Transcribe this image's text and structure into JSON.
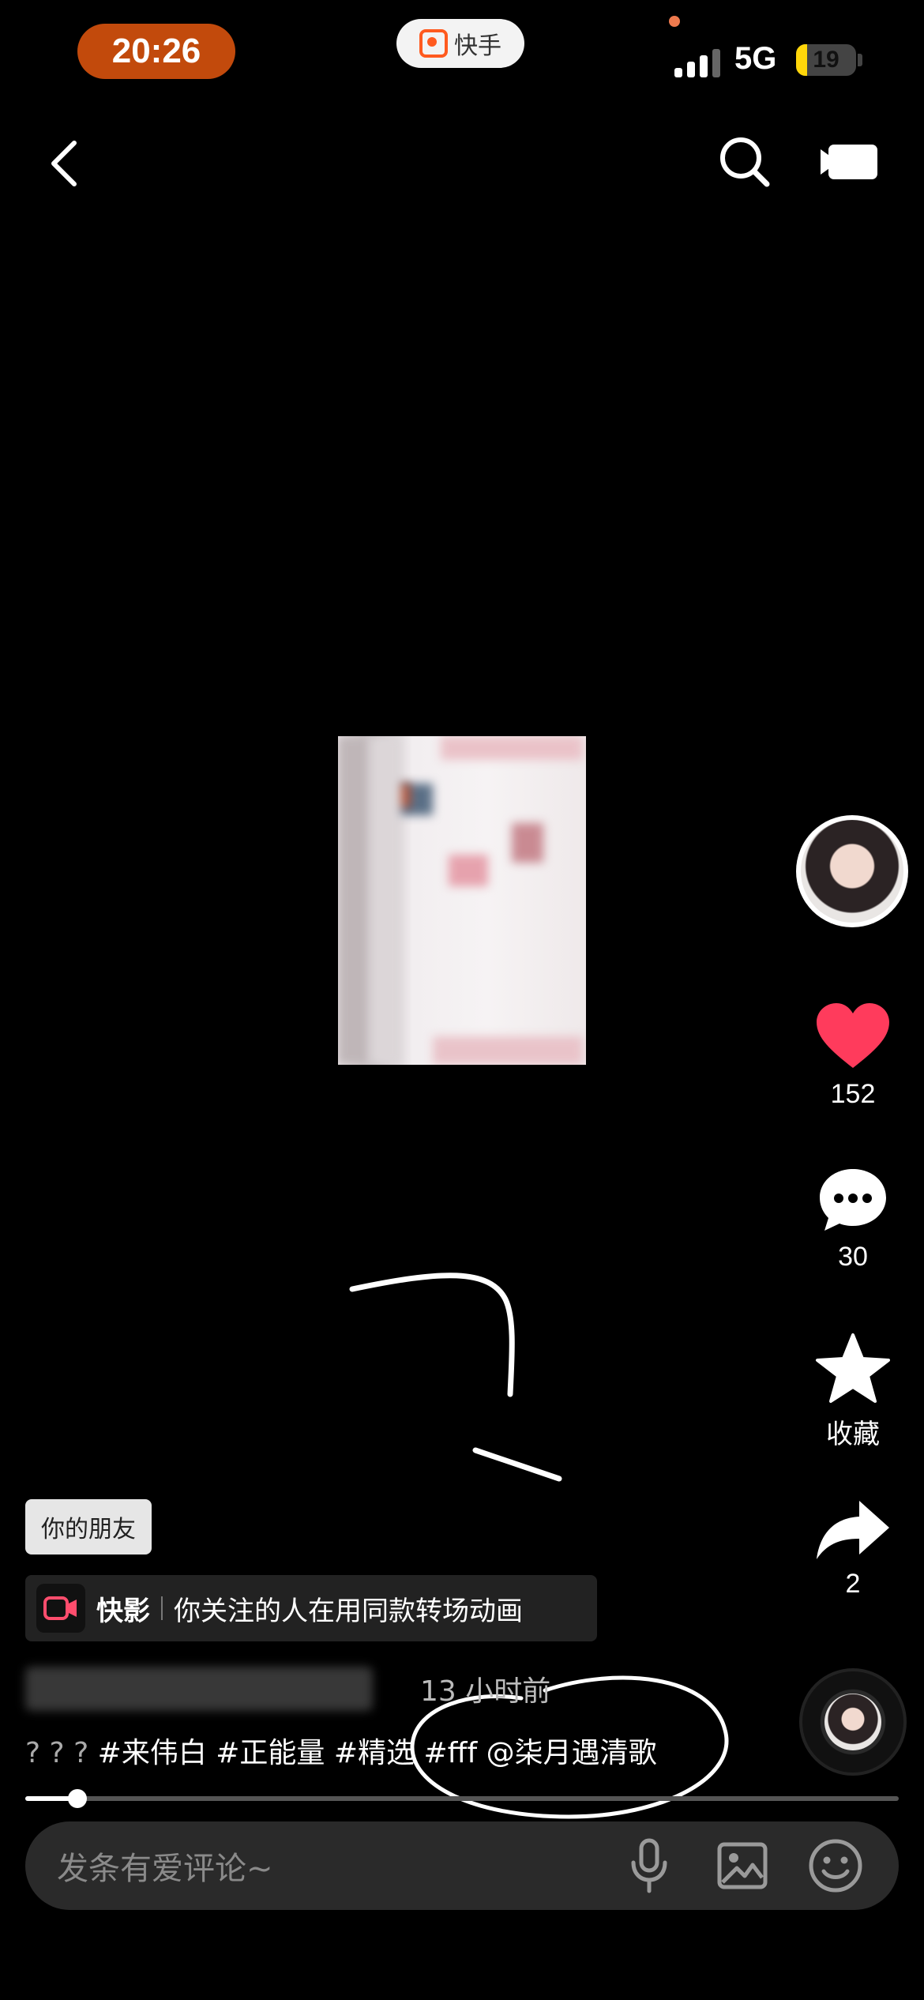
{
  "status_bar": {
    "time": "20:26",
    "app_name": "快手",
    "network": "5G",
    "battery": "19"
  },
  "top_nav": {
    "back_icon": "chevron-left-icon",
    "search_icon": "search-icon",
    "camera_icon": "video-camera-icon"
  },
  "actions": {
    "likes": "152",
    "comments": "30",
    "favorite_label": "收藏",
    "shares": "2"
  },
  "post": {
    "friend_tag": "你的朋友",
    "kuaiying_app": "快影",
    "kuaiying_text": "你关注的人在用同款转场动画",
    "time_ago": "13 小时前",
    "caption_prefix": "? ? ? ",
    "caption_tags": "#来伟白 #正能量 #精选 #fff @柒月遇清歌",
    "progress": 0.06
  },
  "comment_bar": {
    "placeholder": "发条有爱评论~"
  },
  "colors": {
    "like": "#ff3b5c",
    "time_pill": "#c24a0c",
    "brand": "#ff5a1f"
  }
}
